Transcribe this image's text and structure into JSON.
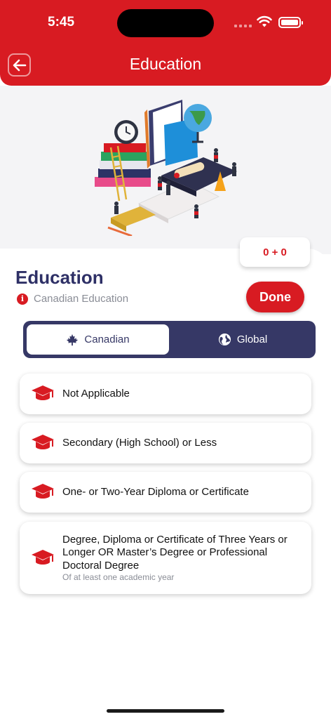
{
  "status_bar": {
    "time": "5:45"
  },
  "header": {
    "title": "Education"
  },
  "score_tab": {
    "value": "0 + 0"
  },
  "section": {
    "title": "Education",
    "subtitle": "Canadian Education",
    "done_label": "Done"
  },
  "segments": {
    "canadian": "Canadian",
    "global": "Global",
    "selected": "Canadian"
  },
  "options": [
    {
      "label": "Not Applicable",
      "note": ""
    },
    {
      "label": "Secondary (High School) or Less",
      "note": ""
    },
    {
      "label": "One- or Two-Year Diploma or Certificate",
      "note": ""
    },
    {
      "label": "Degree, Diploma or Certificate of Three Years or Longer OR Master’s Degree or Professional Doctoral Degree",
      "note": "Of at least one academic year"
    }
  ],
  "colors": {
    "brand_red": "#d81b22",
    "navy": "#363866",
    "title_navy": "#2e3066"
  },
  "icons": {
    "back": "arrow-left-icon",
    "option": "graduation-cap-icon",
    "canadian": "maple-leaf-icon",
    "global": "globe-icon",
    "info": "info-icon"
  }
}
